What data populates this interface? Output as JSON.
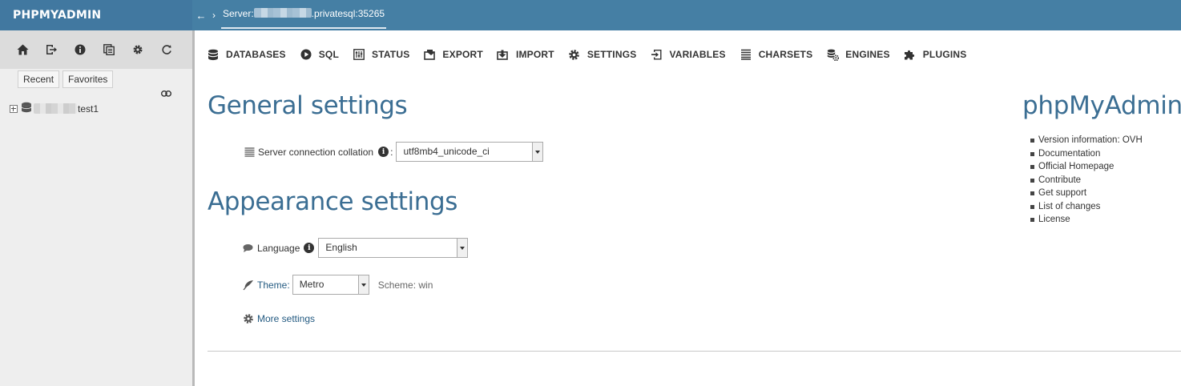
{
  "header": {
    "brand": "PHPMYADMIN",
    "back_icon": "arrow-left-icon",
    "server_prefix": "Server:",
    "server_suffix": ".privatesql:35265"
  },
  "nav": {
    "icons": [
      "home-icon",
      "logout-icon",
      "info-icon",
      "docs-icon",
      "gear-icon",
      "reload-icon"
    ],
    "tabs": [
      "Recent",
      "Favorites"
    ],
    "db_suffix": "test1"
  },
  "tabs": [
    {
      "label": "DATABASES",
      "icon": "database-icon"
    },
    {
      "label": "SQL",
      "icon": "play-icon"
    },
    {
      "label": "STATUS",
      "icon": "status-icon"
    },
    {
      "label": "EXPORT",
      "icon": "export-icon"
    },
    {
      "label": "IMPORT",
      "icon": "import-icon"
    },
    {
      "label": "SETTINGS",
      "icon": "gear-icon"
    },
    {
      "label": "VARIABLES",
      "icon": "variables-icon"
    },
    {
      "label": "CHARSETS",
      "icon": "charsets-icon"
    },
    {
      "label": "ENGINES",
      "icon": "engines-icon"
    },
    {
      "label": "PLUGINS",
      "icon": "plugin-icon"
    }
  ],
  "general": {
    "title": "General settings",
    "collation_label": "Server connection collation",
    "collation_colon": ":",
    "collation_value": "utf8mb4_unicode_ci"
  },
  "appearance": {
    "title": "Appearance settings",
    "language_label": "Language",
    "language_value": "English",
    "theme_label": "Theme:",
    "theme_value": "Metro",
    "scheme_text": "Scheme: win",
    "more_settings": "More settings"
  },
  "sidebar_info": {
    "title": "phpMyAdmin",
    "items": [
      "Version information: OVH",
      "Documentation",
      "Official Homepage",
      "Contribute",
      "Get support",
      "List of changes",
      "License"
    ]
  },
  "colors": {
    "header_bg": "#457fa4",
    "heading": "#3b6e93",
    "link": "#235a81"
  }
}
